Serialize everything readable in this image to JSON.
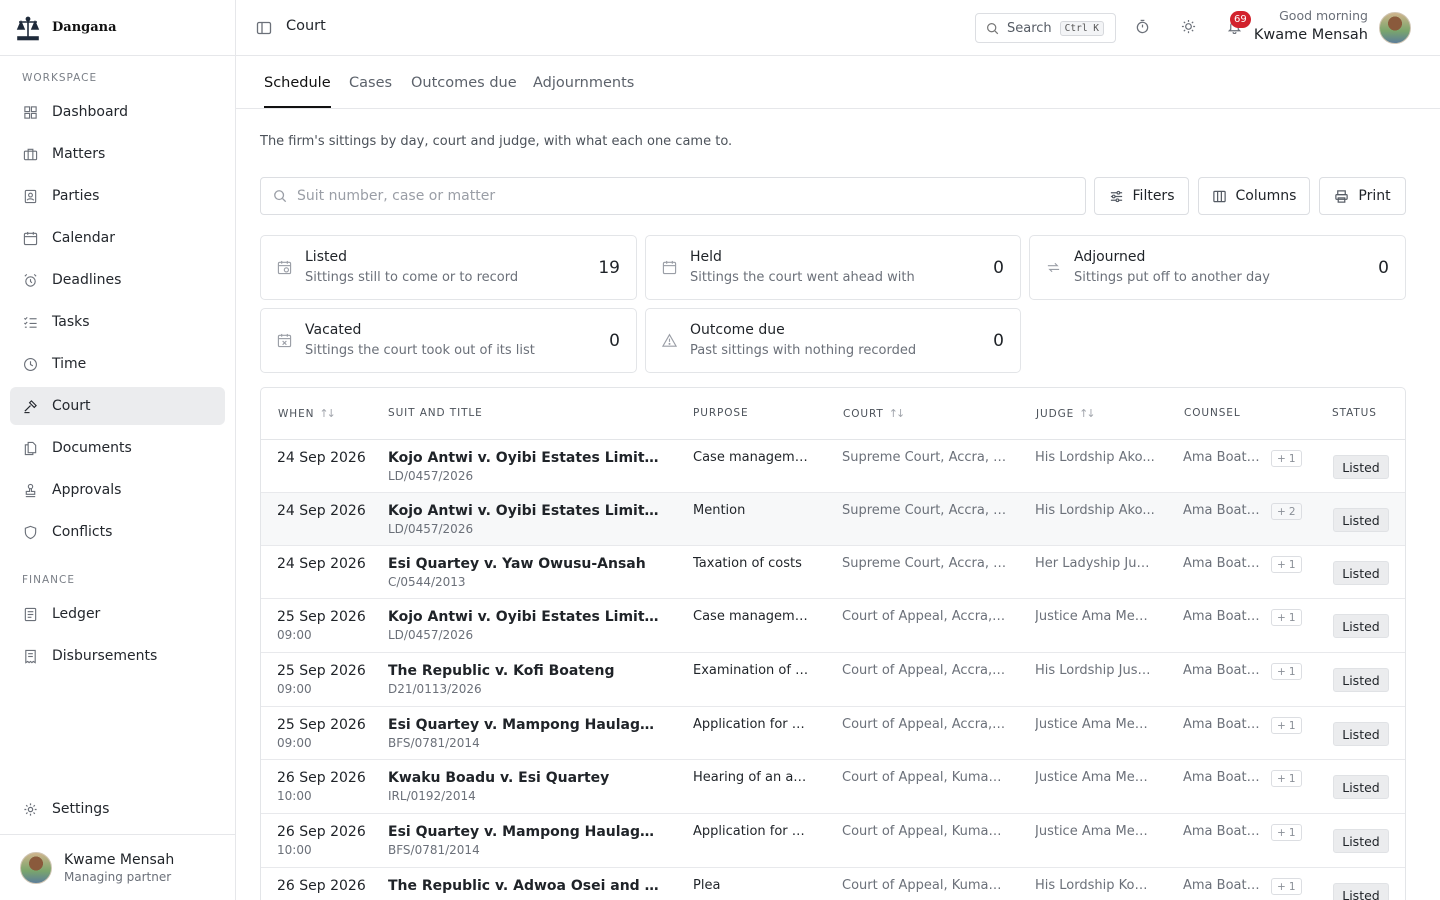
{
  "app": {
    "name": "Dangana"
  },
  "sidebar": {
    "sections": {
      "workspace": "WORKSPACE",
      "finance": "FINANCE"
    },
    "workspace_items": [
      {
        "label": "Dashboard",
        "icon": "grid-icon"
      },
      {
        "label": "Matters",
        "icon": "briefcase-icon"
      },
      {
        "label": "Parties",
        "icon": "contact-card-icon"
      },
      {
        "label": "Calendar",
        "icon": "calendar-icon"
      },
      {
        "label": "Deadlines",
        "icon": "alarm-clock-icon"
      },
      {
        "label": "Tasks",
        "icon": "checklist-icon"
      },
      {
        "label": "Time",
        "icon": "clock-icon"
      },
      {
        "label": "Court",
        "icon": "gavel-icon",
        "active": true
      },
      {
        "label": "Documents",
        "icon": "documents-icon"
      },
      {
        "label": "Approvals",
        "icon": "stamp-icon"
      },
      {
        "label": "Conflicts",
        "icon": "shield-icon"
      }
    ],
    "finance_items": [
      {
        "label": "Ledger",
        "icon": "ledger-icon"
      },
      {
        "label": "Disbursements",
        "icon": "receipt-icon"
      }
    ],
    "settings_label": "Settings",
    "user": {
      "name": "Kwame Mensah",
      "role": "Managing partner"
    }
  },
  "header": {
    "crumb": "Court",
    "search_label": "Search",
    "search_shortcut": "Ctrl K",
    "notifications_count": "69",
    "greeting": "Good morning",
    "user_name": "Kwame Mensah"
  },
  "tabs": [
    {
      "label": "Schedule",
      "active": true
    },
    {
      "label": "Cases"
    },
    {
      "label": "Outcomes due"
    },
    {
      "label": "Adjournments"
    }
  ],
  "description": "The firm's sittings by day, court and judge, with what each one came to.",
  "toolbar": {
    "search_placeholder": "Suit number, case or matter",
    "filters_label": "Filters",
    "columns_label": "Columns",
    "print_label": "Print"
  },
  "stats": [
    {
      "title": "Listed",
      "subtitle": "Sittings still to come or to record",
      "value": "19",
      "icon": "calendar-clock-icon"
    },
    {
      "title": "Held",
      "subtitle": "Sittings the court went ahead with",
      "value": "0",
      "icon": "calendar-check-icon"
    },
    {
      "title": "Adjourned",
      "subtitle": "Sittings put off to another day",
      "value": "0",
      "icon": "repeat-icon"
    },
    {
      "title": "Vacated",
      "subtitle": "Sittings the court took out of its list",
      "value": "0",
      "icon": "calendar-x-icon"
    },
    {
      "title": "Outcome due",
      "subtitle": "Past sittings with nothing recorded",
      "value": "0",
      "icon": "warning-icon"
    }
  ],
  "table": {
    "columns": [
      "WHEN",
      "SUIT AND TITLE",
      "PURPOSE",
      "COURT",
      "JUDGE",
      "COUNSEL",
      "STATUS"
    ],
    "rows": [
      {
        "date": "24 Sep 2026",
        "time": "",
        "title": "Kojo Antwi v. Oyibi Estates Limited and...",
        "suit": "LD/0457/2026",
        "purpose": "Case manageme...",
        "court": "Supreme Court, Accra, C...",
        "judge": "His Lordship Ako...",
        "counsel": "Ama Boate...",
        "extra": "1",
        "status": "Listed"
      },
      {
        "date": "24 Sep 2026",
        "time": "",
        "title": "Kojo Antwi v. Oyibi Estates Limited and...",
        "suit": "LD/0457/2026",
        "purpose": "Mention",
        "court": "Supreme Court, Accra, C...",
        "judge": "His Lordship Ako...",
        "counsel": "Ama Boate...",
        "extra": "2",
        "status": "Listed"
      },
      {
        "date": "24 Sep 2026",
        "time": "",
        "title": "Esi Quartey v. Yaw Owusu-Ansah",
        "suit": "C/0544/2013",
        "purpose": "Taxation of costs",
        "court": "Supreme Court, Accra, C...",
        "judge": "Her Ladyship Just...",
        "counsel": "Ama Boate...",
        "extra": "1",
        "status": "Listed"
      },
      {
        "date": "25 Sep 2026",
        "time": "09:00",
        "title": "Kojo Antwi v. Oyibi Estates Limited and...",
        "suit": "LD/0457/2026",
        "purpose": "Case manageme...",
        "court": "Court of Appeal, Accra, C...",
        "judge": "Justice Ama Men...",
        "counsel": "Ama Boate...",
        "extra": "1",
        "status": "Listed"
      },
      {
        "date": "25 Sep 2026",
        "time": "09:00",
        "title": "The Republic v. Kofi Boateng",
        "suit": "D21/0113/2026",
        "purpose": "Examination of j...",
        "court": "Court of Appeal, Accra, C...",
        "judge": "His Lordship Justi...",
        "counsel": "Ama Boate...",
        "extra": "1",
        "status": "Listed"
      },
      {
        "date": "25 Sep 2026",
        "time": "09:00",
        "title": "Esi Quartey v. Mampong Haulage Limit...",
        "suit": "BFS/0781/2014",
        "purpose": "Application for di...",
        "court": "Court of Appeal, Accra, C...",
        "judge": "Justice Ama Men...",
        "counsel": "Ama Boate...",
        "extra": "1",
        "status": "Listed"
      },
      {
        "date": "26 Sep 2026",
        "time": "10:00",
        "title": "Kwaku Boadu v. Esi Quartey",
        "suit": "IRL/0192/2014",
        "purpose": "Hearing of an ap...",
        "court": "Court of Appeal, Kumasi,...",
        "judge": "Justice Ama Men...",
        "counsel": "Ama Boate...",
        "extra": "1",
        "status": "Listed"
      },
      {
        "date": "26 Sep 2026",
        "time": "10:00",
        "title": "Esi Quartey v. Mampong Haulage Limit...",
        "suit": "BFS/0781/2014",
        "purpose": "Application for di...",
        "court": "Court of Appeal, Kumasi,...",
        "judge": "Justice Ama Men...",
        "counsel": "Ama Boate...",
        "extra": "1",
        "status": "Listed"
      },
      {
        "date": "26 Sep 2026",
        "time": "",
        "title": "The Republic v. Adwoa Osei and Another",
        "suit": "",
        "purpose": "Plea",
        "court": "Court of Appeal, Kumasi,...",
        "judge": "His Lordship Kofi...",
        "counsel": "Ama Boate...",
        "extra": "1",
        "status": "Listed"
      }
    ]
  }
}
